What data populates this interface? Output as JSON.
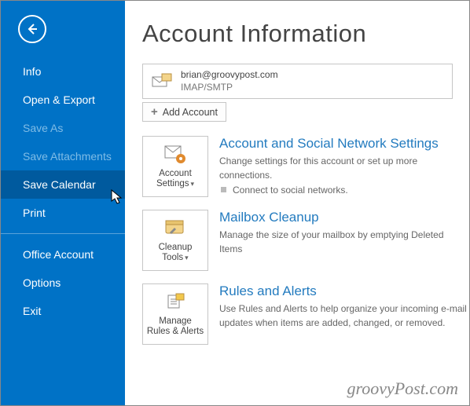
{
  "sidebar": {
    "items": [
      {
        "label": "Info",
        "state": "normal"
      },
      {
        "label": "Open & Export",
        "state": "normal"
      },
      {
        "label": "Save As",
        "state": "disabled"
      },
      {
        "label": "Save Attachments",
        "state": "disabled"
      },
      {
        "label": "Save Calendar",
        "state": "hover"
      },
      {
        "label": "Print",
        "state": "normal"
      }
    ],
    "items2": [
      {
        "label": "Office Account"
      },
      {
        "label": "Options"
      },
      {
        "label": "Exit"
      }
    ]
  },
  "page": {
    "title": "Account Information",
    "account_email": "brian@groovypost.com",
    "account_protocol": "IMAP/SMTP",
    "add_account_label": "Add Account",
    "watermark": "groovyPost.com"
  },
  "cards": [
    {
      "tile_label": "Account Settings",
      "has_caret": true,
      "title": "Account and Social Network Settings",
      "desc": "Change settings for this account or set up more connections.",
      "bullet": "Connect to social networks."
    },
    {
      "tile_label": "Cleanup Tools",
      "has_caret": true,
      "title": "Mailbox Cleanup",
      "desc": "Manage the size of your mailbox by emptying Deleted Items"
    },
    {
      "tile_label": "Manage Rules & Alerts",
      "has_caret": false,
      "title": "Rules and Alerts",
      "desc": "Use Rules and Alerts to help organize your incoming e-mail updates when items are added, changed, or removed."
    }
  ]
}
